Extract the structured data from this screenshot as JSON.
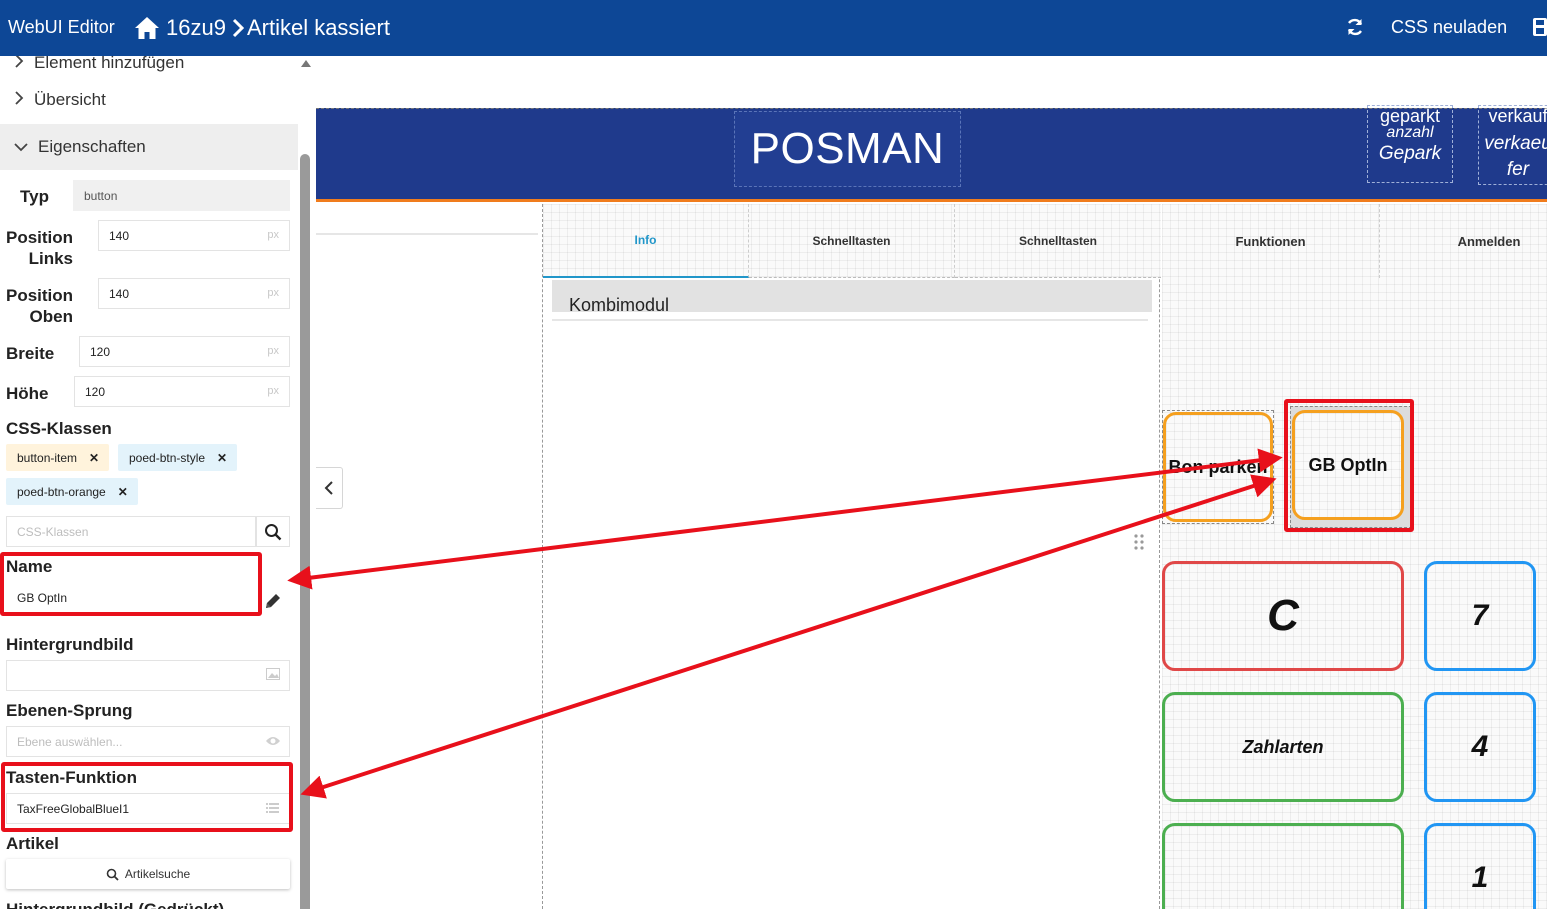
{
  "topbar": {
    "app_title": "WebUI Editor",
    "crumb_1": "16zu9",
    "crumb_2": "Artikel kassiert",
    "reload_label": "CSS neuladen"
  },
  "sidebar": {
    "partial_item": "Element hinzufügen",
    "overview_label": "Übersicht",
    "properties_label": "Eigenschaften",
    "type_label": "Typ",
    "type_value": "button",
    "pos_left_label_1": "Position",
    "pos_left_label_2": "Links",
    "pos_left_value": "140",
    "pos_top_label_1": "Position",
    "pos_top_label_2": "Oben",
    "pos_top_value": "140",
    "width_label": "Breite",
    "width_value": "120",
    "height_label": "Höhe",
    "height_value": "120",
    "unit": "px",
    "css_classes_label": "CSS-Klassen",
    "css_classes": [
      "button-item",
      "poed-btn-style",
      "poed-btn-orange"
    ],
    "css_classes_placeholder": "CSS-Klassen",
    "name_label": "Name",
    "name_value": "GB OptIn",
    "bg_image_label": "Hintergrundbild",
    "layer_jump_label": "Ebenen-Sprung",
    "layer_jump_placeholder": "Ebene auswählen...",
    "key_function_label": "Tasten-Funktion",
    "key_function_value": "TaxFreeGlobalBlueI1",
    "article_label": "Artikel",
    "article_search_label": "Artikelsuche",
    "bg_image_pressed_label": "Hintergrundbild (Gedrückt)"
  },
  "canvas": {
    "header_title": "POSMAN",
    "header_mini_1": [
      "geparkt",
      "anzahl",
      "Gepark"
    ],
    "header_mini_2": [
      "verkauf",
      "verkaeu",
      "fer"
    ],
    "tabs": [
      "Info",
      "Schnelltasten",
      "Schnelltasten"
    ],
    "module_title": "Kombimodul",
    "right_tabs": [
      "Funktionen",
      "Anmelden"
    ],
    "keys": {
      "bon_parken": "Bon parken",
      "gb_optin": "GB OptIn",
      "c": "C",
      "seven": "7",
      "zahlarten": "Zahlarten",
      "four": "4",
      "one": "1"
    }
  },
  "colors": {
    "topbar": "#0d4796",
    "pos_header": "#1f3a8c",
    "accent_orange": "#f5a01f",
    "key_red": "#e04848",
    "key_green": "#4caf50",
    "key_blue": "#2196f3",
    "annotation_red": "#e8101b",
    "active_tab": "#2196c9"
  },
  "icons": [
    "home-icon",
    "chevron-right-icon",
    "reload-icon",
    "save-icon",
    "chevron-down-icon",
    "remove-chip-icon",
    "search-icon",
    "pencil-icon",
    "image-icon",
    "eye-icon",
    "list-icon",
    "drag-handle-icon",
    "collapse-chevron-icon"
  ]
}
